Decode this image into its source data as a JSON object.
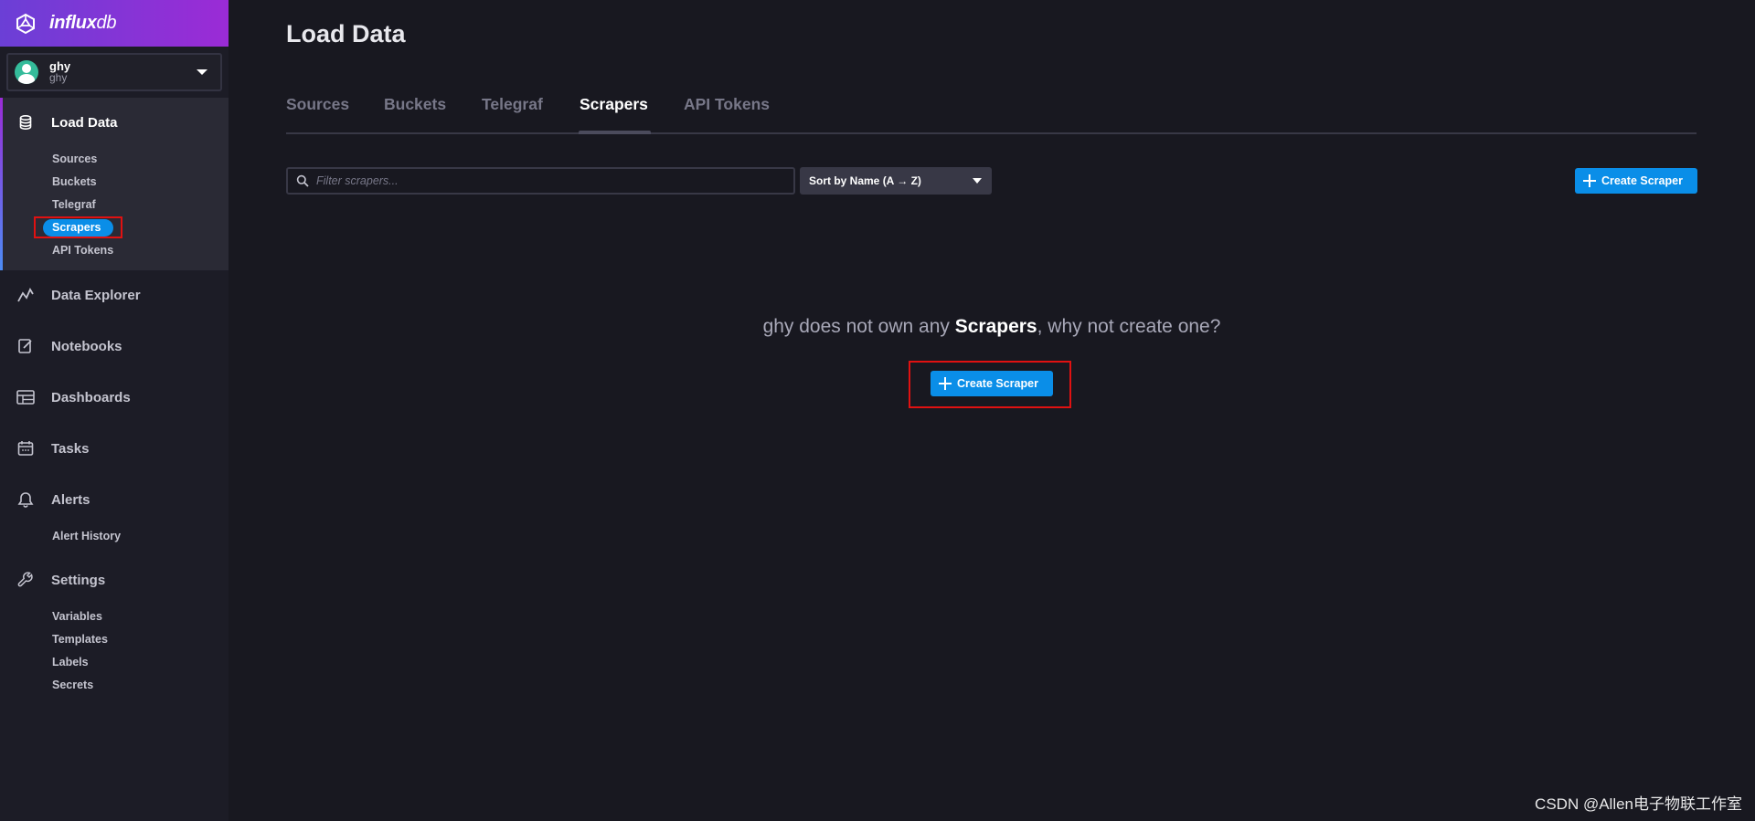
{
  "brand": {
    "name_bold": "influx",
    "name_thin": "db"
  },
  "account": {
    "name": "ghy",
    "org": "ghy"
  },
  "nav": {
    "load_data": "Load Data",
    "load_data_sub": [
      "Sources",
      "Buckets",
      "Telegraf",
      "Scrapers",
      "API Tokens"
    ],
    "data_explorer": "Data Explorer",
    "notebooks": "Notebooks",
    "dashboards": "Dashboards",
    "tasks": "Tasks",
    "alerts": "Alerts",
    "alerts_sub": [
      "Alert History"
    ],
    "settings": "Settings",
    "settings_sub": [
      "Variables",
      "Templates",
      "Labels",
      "Secrets"
    ]
  },
  "page": {
    "title": "Load Data",
    "tabs": [
      "Sources",
      "Buckets",
      "Telegraf",
      "Scrapers",
      "API Tokens"
    ],
    "active_tab": "Scrapers"
  },
  "toolbar": {
    "search_placeholder": "Filter scrapers...",
    "sort_label": "Sort by Name (A → Z)",
    "create_label": "Create Scraper"
  },
  "empty_state": {
    "prefix": "ghy does not own any ",
    "bold": "Scrapers",
    "suffix": ", why not create one?",
    "button_label": "Create Scraper"
  },
  "watermark": "CSDN @Allen电子物联工作室",
  "colors": {
    "accent": "#0a8ee8",
    "highlight": "#e01111",
    "brand_start": "#6b3fd6",
    "brand_end": "#9b2bd6"
  }
}
